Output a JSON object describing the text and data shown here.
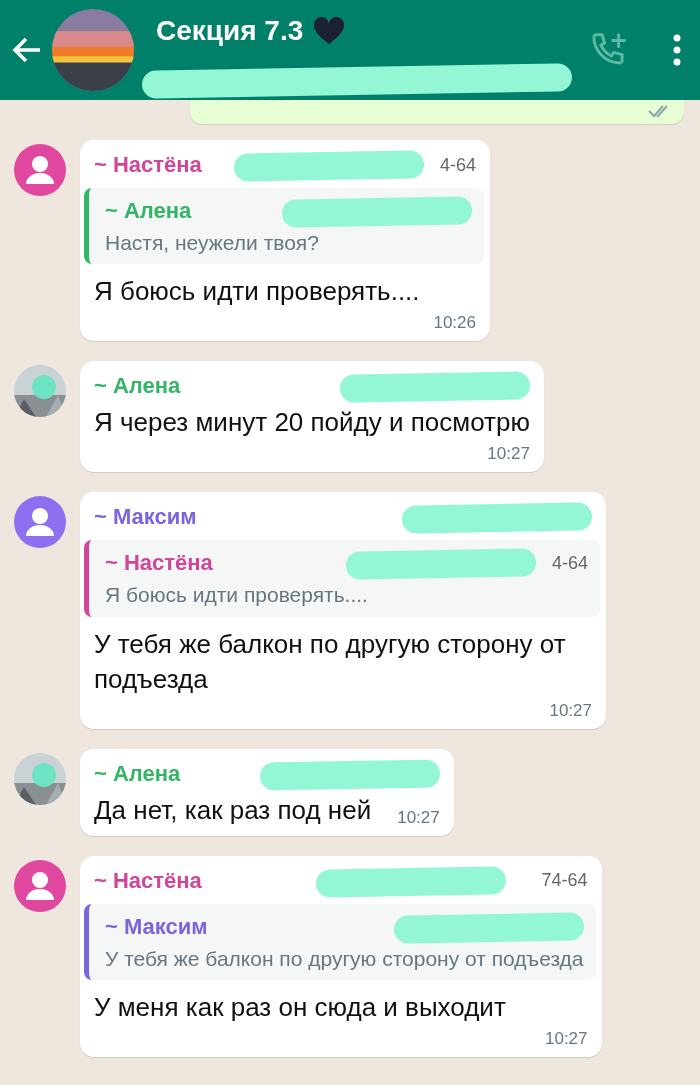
{
  "header": {
    "title": "Секция 7.3",
    "call_disabled": true
  },
  "messages": [
    {
      "avatar": {
        "kind": "default",
        "color": "#e0489f"
      },
      "sender": "~ Настёна",
      "color": "#d0469a",
      "phone": "4-64",
      "quote": {
        "sender": "~ Алена",
        "color": "#33b566"
      },
      "quote_text": "Настя, неужели твоя?",
      "text": "Я боюсь идти проверять....",
      "time": "10:26"
    },
    {
      "sender": "~ Алена",
      "color": "#33b566",
      "text": "Я через минут 20 пойду и посмотрю",
      "time": "10:27"
    },
    {
      "avatar": {
        "kind": "default",
        "color": "#8e6ff0"
      },
      "sender": "~ Максим",
      "color": "#7c63e0",
      "quote": {
        "sender": "~ Настёна",
        "color": "#d0469a",
        "phone": "4-64"
      },
      "quote_text": "Я боюсь идти проверять....",
      "text": "У тебя же балкон по другую сторону от подъезда",
      "time": "10:27"
    },
    {
      "sender": "~ Алена",
      "color": "#33b566",
      "text": "Да нет, как раз под ней",
      "time": "10:27",
      "inline_time": true
    },
    {
      "avatar": {
        "kind": "default",
        "color": "#e0489f"
      },
      "sender": "~ Настёна",
      "color": "#d0469a",
      "phone": "74-64",
      "quote": {
        "sender": "~ Максим",
        "color": "#7c63e0"
      },
      "quote_text": "У тебя же балкон по другую сторону от подъезда",
      "text": "У меня как раз он сюда и выходит",
      "time": "10:27"
    }
  ]
}
